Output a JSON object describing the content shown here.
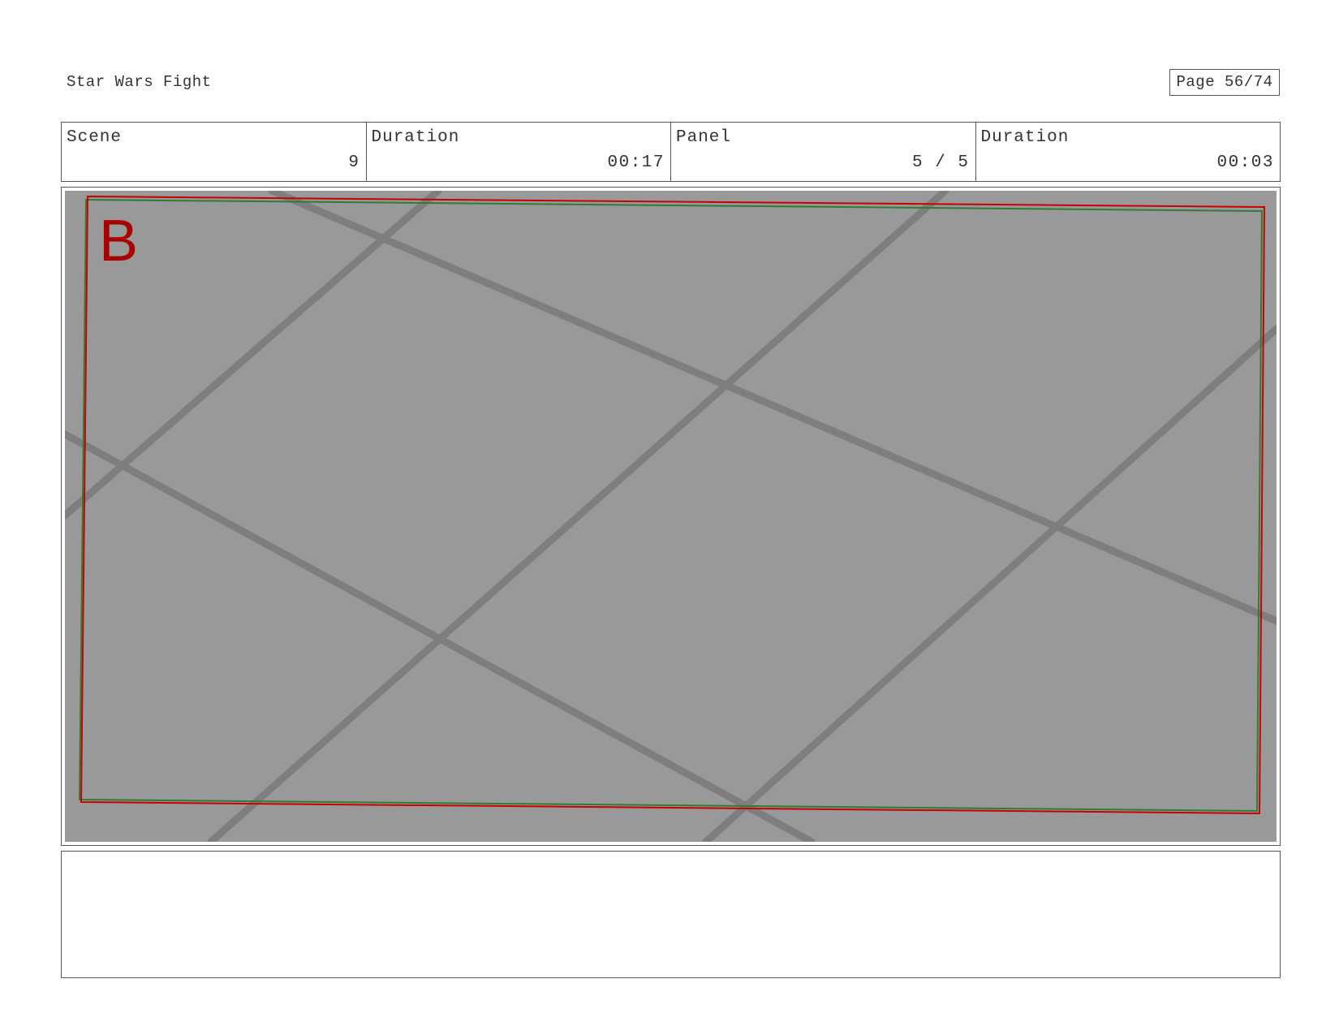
{
  "header": {
    "title": "Star Wars Fight",
    "page_label": "Page 56/74"
  },
  "info": {
    "scene_label": "Scene",
    "scene_value": "9",
    "scene_duration_label": "Duration",
    "scene_duration_value": "00:17",
    "panel_label": "Panel",
    "panel_value": "5 / 5",
    "panel_duration_label": "Duration",
    "panel_duration_value": "00:03"
  },
  "panel": {
    "marker_letter": "B",
    "background_color": "#999999",
    "grid_line_color": "#7a7a7a",
    "frame_red": "#cc0000",
    "frame_green": "#2e7d32",
    "marker_color": "#aa0000"
  },
  "notes": {
    "text": ""
  }
}
